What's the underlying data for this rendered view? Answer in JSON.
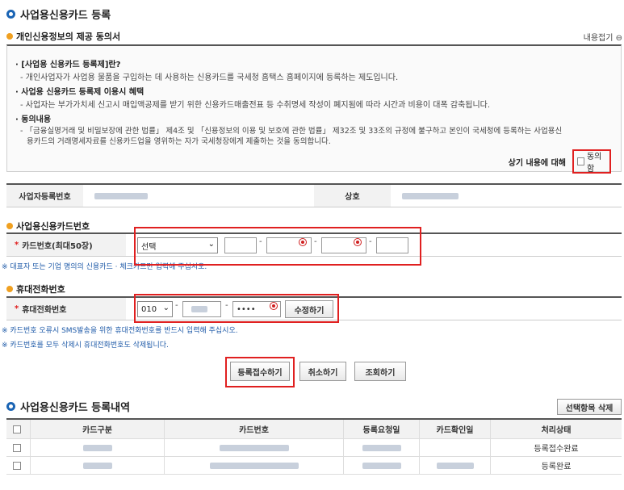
{
  "page": {
    "title": "사업용신용카드 등록"
  },
  "consent": {
    "title": "개인신용정보의 제공 동의서",
    "collapse_label": "내용접기 ⊖",
    "sections": [
      {
        "title": "· [사업용 신용카드 등록제]란?",
        "desc": "- 개인사업자가 사업용 물품을 구입하는 데 사용하는 신용카드를 국세청 홈택스 홈페이지에 등록하는 제도입니다."
      },
      {
        "title": "· 사업용 신용카드 등록제 이용시 혜택",
        "desc": "- 사업자는 부가가치세 신고시 매입액공제를 받기 위한 신용카드매출전표 등 수취명세 작성이 폐지됨에 따라 시간과 비용이 대폭 감축됩니다."
      },
      {
        "title": "· 동의내용",
        "desc": "- 「금융실명거래 및 비밀보장에 관한 법률」 제4조 및 「신용정보의 이용 및 보호에 관한 법률」 제32조 및 33조의 규정에 불구하고 본인이 국세청에 등록하는 사업용신",
        "desc2": "용카드의  거래명세자료를 신용카드업을 영위하는 자가 국세청장에게 제출하는 것을 동의합니다."
      }
    ],
    "agree_prefix": "상기 내용에 대해",
    "agree_label": "동의함"
  },
  "business": {
    "reg_no_label": "사업자등록번호",
    "name_label": "상호"
  },
  "card": {
    "section_title": "사업용신용카드번호",
    "label": "카드번호(최대50장)",
    "select_value": "선택",
    "note": "※ 대표자 또는 기업 명의의 신용카드 · 체크카드만 입력해 주십시오."
  },
  "phone": {
    "section_title": "휴대전화번호",
    "label": "휴대전화번호",
    "prefix_value": "010",
    "masked_value": "••••",
    "edit_button": "수정하기",
    "note1": "※ 카드번호 오류시 SMS발송을 위한 휴대전화번호를 반드시 입력해 주십시오.",
    "note2": "※ 카드번호를 모두 삭제시 휴대전화번호도 삭제됩니다."
  },
  "actions": {
    "register": "등록접수하기",
    "cancel": "취소하기",
    "inquiry": "조회하기"
  },
  "history": {
    "title": "사업용신용카드 등록내역",
    "delete_selected": "선택항목 삭제",
    "columns": [
      "카드구분",
      "카드번호",
      "등록요청일",
      "카드확인일",
      "처리상태"
    ],
    "rows": [
      {
        "status": "등록접수완료"
      },
      {
        "status": "등록완료"
      }
    ]
  },
  "colors": {
    "accent_blue": "#1a64b4",
    "section_orange": "#f0a020",
    "highlight_red": "#e02020"
  }
}
